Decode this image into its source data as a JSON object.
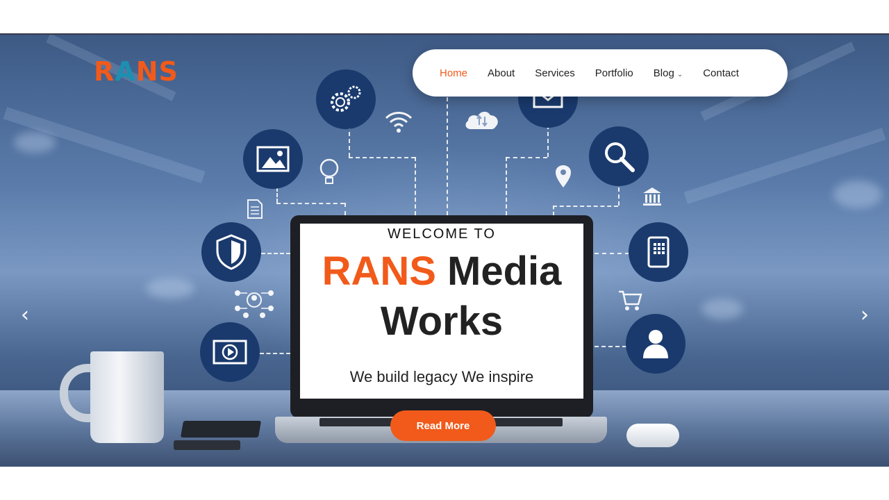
{
  "brand": {
    "logo_left": "R",
    "logo_mid": "A",
    "logo_right": "NS"
  },
  "nav": {
    "items": [
      {
        "label": "Home",
        "active": true
      },
      {
        "label": "About"
      },
      {
        "label": "Services"
      },
      {
        "label": "Portfolio"
      },
      {
        "label": "Blog",
        "has_dropdown": true
      },
      {
        "label": "Contact"
      }
    ]
  },
  "hero": {
    "welcome": "WELCOME TO",
    "title_brand": "RANS",
    "title_rest": " Media",
    "title_line2": "Works",
    "tagline": "We build legacy We inspire",
    "cta": "Read More"
  },
  "slider": {
    "prev_icon": "‹",
    "next_icon": "›"
  },
  "colors": {
    "accent": "#f15a1a",
    "icon_circle": "#1a3a6e",
    "logo_teal": "#1d8fb0"
  }
}
